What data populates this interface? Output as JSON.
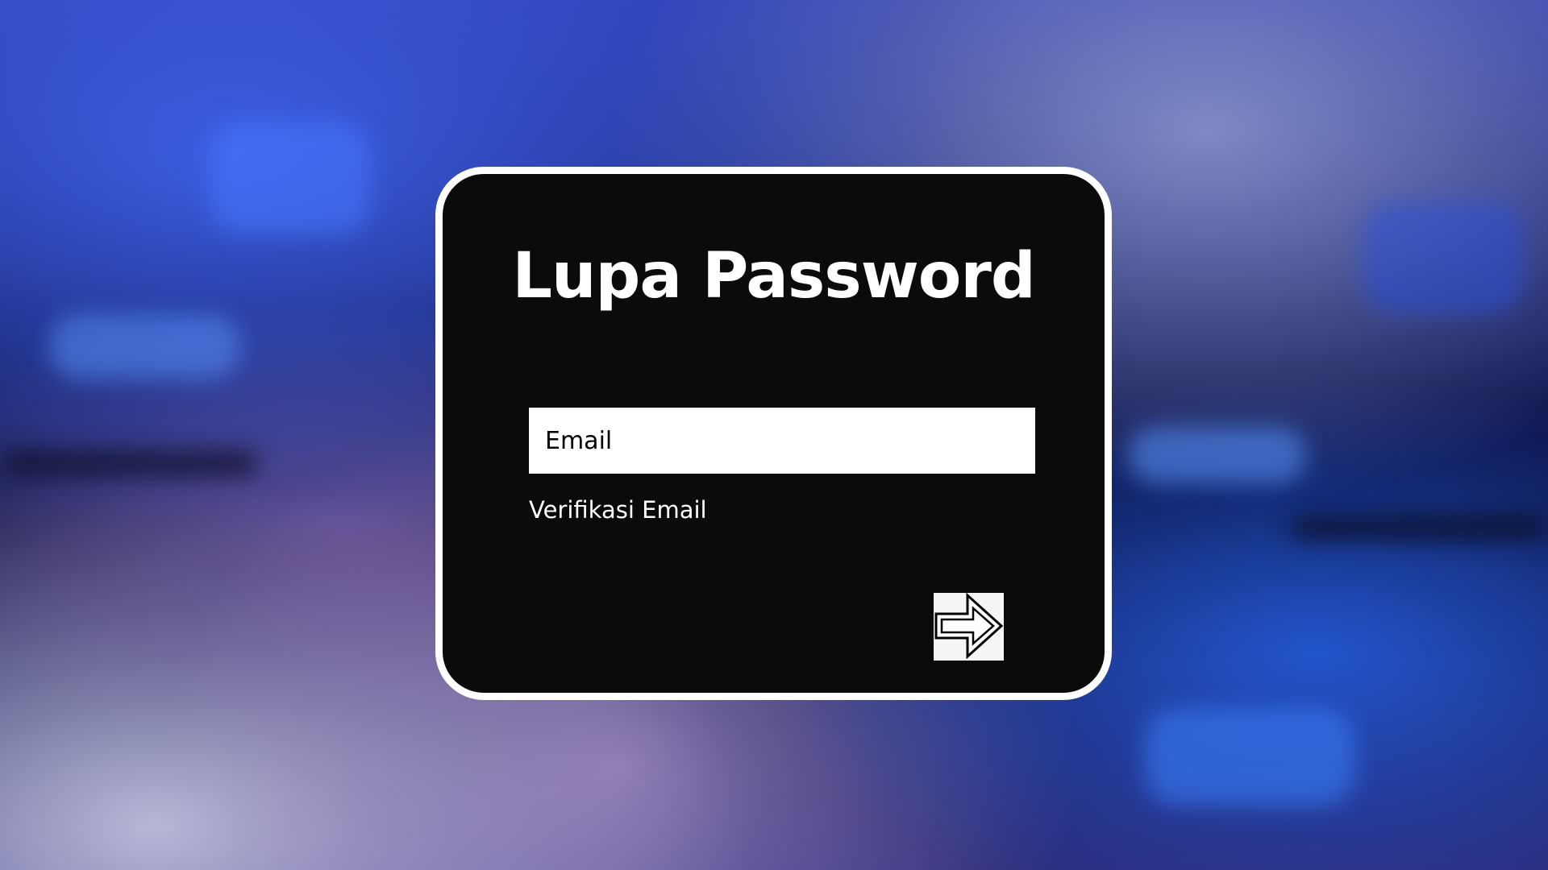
{
  "form": {
    "title": "Lupa Password",
    "email_placeholder": "Email",
    "verify_label": "Verifikasi Email",
    "submit_icon": "arrow-right-icon"
  },
  "colors": {
    "card_background": "#0b0b0b",
    "card_border": "#ffffff",
    "input_background": "#ffffff",
    "button_background": "#f5f5f5"
  }
}
